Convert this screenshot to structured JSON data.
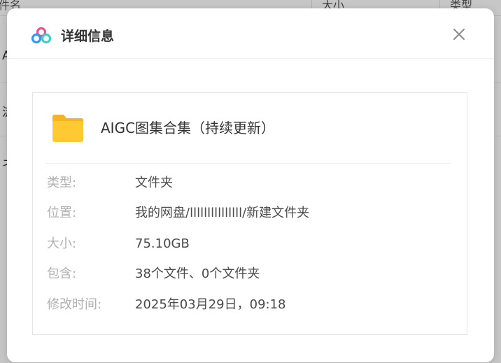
{
  "background": {
    "columns": [
      "件名",
      "大小",
      "类型"
    ],
    "rows": [
      "A",
      "流",
      "ネ"
    ]
  },
  "dialog": {
    "title": "详细信息",
    "logo_icon": "baidu-netdisk-logo-icon",
    "close_icon": "close-icon",
    "file": {
      "icon": "folder-icon",
      "name": "AIGC图集合集（持续更新）"
    },
    "details": [
      {
        "label": "类型:",
        "value": "文件夹"
      },
      {
        "label": "位置:",
        "value": "我的网盘/lllllllllllllll/新建文件夹"
      },
      {
        "label": "大小:",
        "value": "75.10GB"
      },
      {
        "label": "包含:",
        "value": "38个文件、0个文件夹"
      },
      {
        "label": "修改时间:",
        "value": "2025年03月29日，09:18"
      }
    ]
  },
  "colors": {
    "folder_yellow": "#FFC933",
    "logo_blue": "#2E9BF0",
    "logo_teal": "#3BD1C4",
    "logo_pink": "#F0508C"
  }
}
